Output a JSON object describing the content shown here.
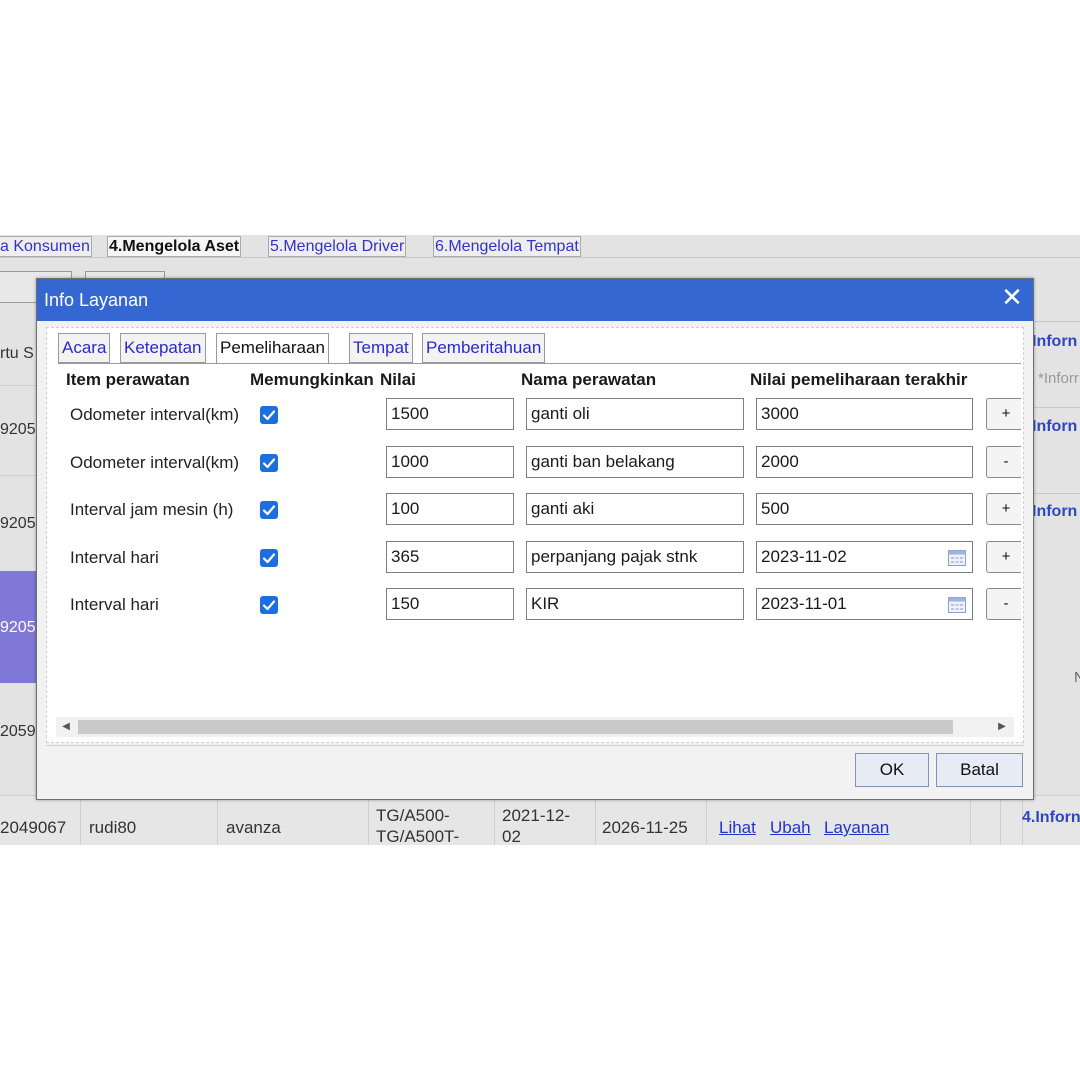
{
  "background": {
    "tabs": [
      "a Konsumen",
      "4.Mengelola Aset",
      "5.Mengelola Driver",
      "6.Mengelola Tempat"
    ],
    "left_col_header": "rtu S",
    "left_col_cells": [
      "9205",
      "9205",
      "9205",
      "2059"
    ],
    "right_panel": [
      "Inforn",
      "Inforn",
      "Inforn",
      "4.Inforn"
    ],
    "right_panel_sub": "*Inforr",
    "right_panel_n": "N",
    "bottom_row": {
      "id": "2049067",
      "user": "rudi80",
      "model": "avanza",
      "plate_line1": "TG/A500-",
      "plate_line2": "TG/A500T-",
      "date1_line1": "2021-12-",
      "date1_line2": "02",
      "date2": "2026-11-25",
      "links": [
        "Lihat",
        "Ubah",
        "Layanan"
      ]
    }
  },
  "dialog": {
    "title": "Info Layanan",
    "close_glyph": "✕",
    "tabs": [
      "Acara",
      "Ketepatan",
      "Pemeliharaan",
      "Tempat",
      "Pemberitahuan"
    ],
    "active_tab": "Pemeliharaan",
    "columns": {
      "item": "Item perawatan",
      "enable": "Memungkinkan",
      "value": "Nilai",
      "name": "Nama perawatan",
      "last": "Nilai pemeliharaan terakhir"
    },
    "rows": [
      {
        "item": "Odometer interval(km)",
        "enabled": true,
        "value": "1500",
        "name": "ganti oli",
        "last": "3000",
        "calendar": false,
        "action": "+"
      },
      {
        "item": "Odometer interval(km)",
        "enabled": true,
        "value": "1000",
        "name": "ganti ban belakang",
        "last": "2000",
        "calendar": false,
        "action": "-"
      },
      {
        "item": "Interval jam mesin (h)",
        "enabled": true,
        "value": "100",
        "name": "ganti aki",
        "last": "500",
        "calendar": false,
        "action": "+"
      },
      {
        "item": "Interval hari",
        "enabled": true,
        "value": "365",
        "name": "perpanjang pajak stnk",
        "last": "2023-11-02",
        "calendar": true,
        "action": "+"
      },
      {
        "item": "Interval hari",
        "enabled": true,
        "value": "150",
        "name": "KIR",
        "last": "2023-11-01",
        "calendar": true,
        "action": "-"
      }
    ],
    "buttons": {
      "ok": "OK",
      "cancel": "Batal"
    }
  }
}
